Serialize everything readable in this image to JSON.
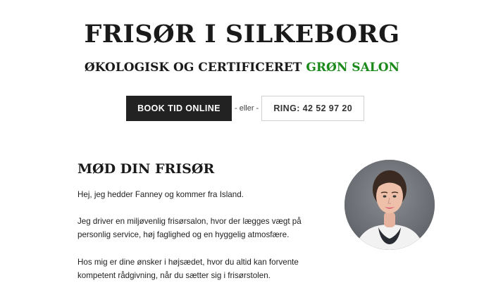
{
  "header": {
    "title": "FRISØR I SILKEBORG",
    "subtitle_prefix": "ØKOLOGISK OG CERTIFICERET",
    "subtitle_highlight": "GRØN SALON"
  },
  "cta": {
    "book_label": "BOOK TID ONLINE",
    "or_text": "- eller -",
    "call_label": "RING: 42 52 97 20"
  },
  "about": {
    "heading": "MØD DIN FRISØR",
    "paragraphs": [
      "Hej, jeg hedder Fanney og kommer fra Island.",
      "Jeg driver en miljøvenlig frisørsalon, hvor der lægges vægt på personlig service, høj faglighed og en hyggelig atmosfære.",
      "Hos mig er dine ønsker i højsædet, hvor du altid kan forvente kompetent rådgivning, når du sætter sig i frisørstolen."
    ]
  },
  "colors": {
    "accent_green": "#1b8a1b",
    "button_dark": "#222222",
    "avatar_background": "#6f7278"
  }
}
